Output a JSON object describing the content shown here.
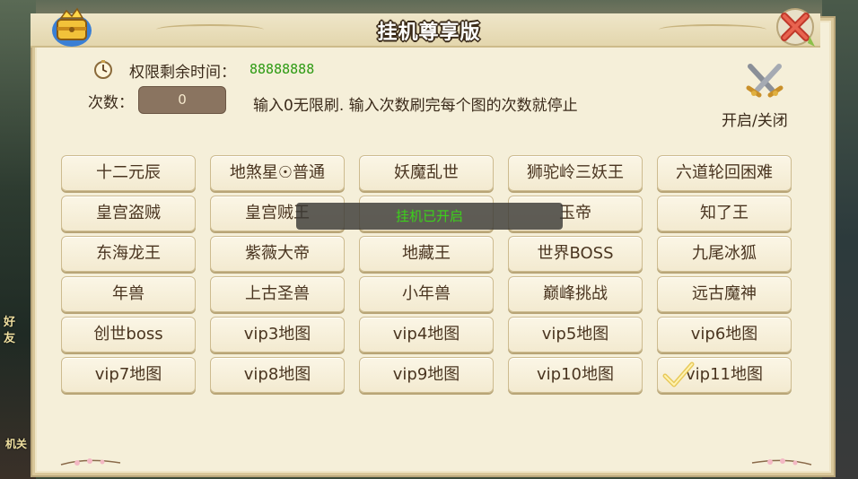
{
  "window": {
    "title": "挂机尊享版"
  },
  "permission": {
    "label": "权限剩余时间：",
    "value": "88888888"
  },
  "count": {
    "label": "次数：",
    "value": "0",
    "hint": "输入0无限刷. 输入次数刷完每个图的次数就停止"
  },
  "toggle": {
    "label": "开启/关闭"
  },
  "maps": [
    {
      "label": "十二元辰"
    },
    {
      "label": "地煞星☉普通"
    },
    {
      "label": "妖魔乱世"
    },
    {
      "label": "狮驼岭三妖王"
    },
    {
      "label": "六道轮回困难"
    },
    {
      "label": "皇宫盗贼"
    },
    {
      "label": "皇宫贼王"
    },
    {
      "label": ""
    },
    {
      "label": "玉帝"
    },
    {
      "label": "知了王"
    },
    {
      "label": "东海龙王"
    },
    {
      "label": "紫薇大帝"
    },
    {
      "label": "地藏王"
    },
    {
      "label": "世界BOSS"
    },
    {
      "label": "九尾冰狐"
    },
    {
      "label": "年兽"
    },
    {
      "label": "上古圣兽"
    },
    {
      "label": "小年兽"
    },
    {
      "label": "巅峰挑战"
    },
    {
      "label": "远古魔神"
    },
    {
      "label": "创世boss"
    },
    {
      "label": "vip3地图"
    },
    {
      "label": "vip4地图"
    },
    {
      "label": "vip5地图"
    },
    {
      "label": "vip6地图"
    },
    {
      "label": "vip7地图"
    },
    {
      "label": "vip8地图"
    },
    {
      "label": "vip9地图"
    },
    {
      "label": "vip10地图"
    },
    {
      "label": "vip11地图",
      "checked": true
    }
  ],
  "toast": {
    "text": "挂机已开启"
  },
  "background": {
    "left_text_1": "好",
    "left_text_2": "友",
    "left_text_3": "机关"
  },
  "colors": {
    "panel": "#f5efd9",
    "timer_value": "#2c9a12",
    "toast_text": "#3cd21a",
    "input_bg": "#8a7460"
  }
}
